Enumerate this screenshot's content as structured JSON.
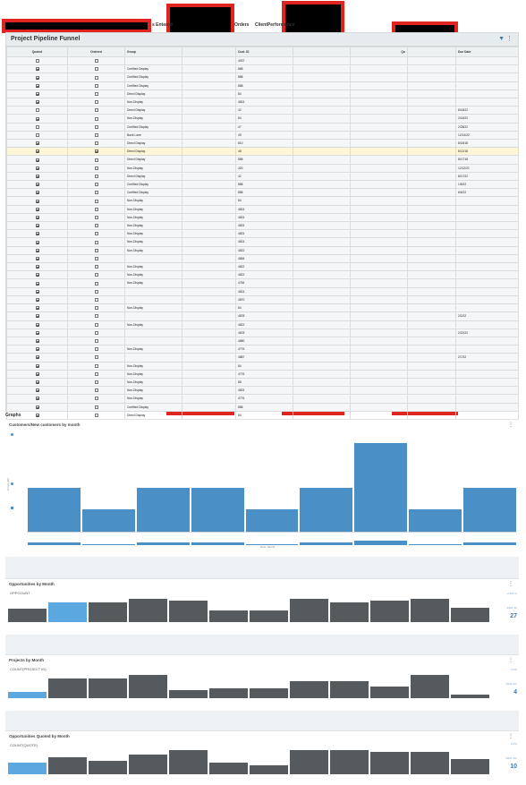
{
  "tabs": [
    "s Entered",
    "Orders",
    "ClientPerformance"
  ],
  "panel": {
    "title": "Project Pipeline Funnel",
    "filter_icon": "filter-icon",
    "menu_icon": "kebab-menu-icon",
    "columns": [
      "Quoted",
      "Ordered",
      "Group",
      "Cust. ID",
      "Qu",
      "Due Date"
    ]
  },
  "rows": [
    {
      "q": false,
      "o": false,
      "g": "",
      "id": "4937",
      "due": ""
    },
    {
      "q": true,
      "o": false,
      "g": "Certified Display",
      "id": "888",
      "due": ""
    },
    {
      "q": true,
      "o": false,
      "g": "Certified Display",
      "id": "888",
      "due": ""
    },
    {
      "q": true,
      "o": false,
      "g": "Certified Display",
      "id": "888",
      "due": ""
    },
    {
      "q": true,
      "o": false,
      "g": "Direct Display",
      "id": "84",
      "due": ""
    },
    {
      "q": true,
      "o": false,
      "g": "Non-Display",
      "id": "4824",
      "due": ""
    },
    {
      "q": false,
      "o": false,
      "g": "Direct Display",
      "id": "42",
      "due": "8/18/22"
    },
    {
      "q": true,
      "o": false,
      "g": "Non-Display",
      "id": "84",
      "due": "2/16/22"
    },
    {
      "q": false,
      "o": false,
      "g": "Certified Display",
      "id": "47",
      "due": "2/28/22"
    },
    {
      "q": false,
      "o": false,
      "g": "Bank Lane",
      "id": "49",
      "due": "12/14/22"
    },
    {
      "q": true,
      "o": false,
      "g": "Direct Display",
      "id": "810",
      "due": "8/18/18"
    },
    {
      "q": true,
      "o": true,
      "g": "Direct Display",
      "id": "48",
      "due": "8/12/18",
      "hl": true
    },
    {
      "q": true,
      "o": false,
      "g": "Direct Display",
      "id": "888",
      "due": "8/17/18"
    },
    {
      "q": true,
      "o": false,
      "g": "Non-Display",
      "id": "420",
      "due": "12/12/21"
    },
    {
      "q": true,
      "o": false,
      "g": "Direct Display",
      "id": "42",
      "due": "8/17/22"
    },
    {
      "q": true,
      "o": false,
      "g": "Certified Display",
      "id": "888",
      "due": "1/8/22"
    },
    {
      "q": true,
      "o": false,
      "g": "Certified Display",
      "id": "888",
      "due": "6/6/22"
    },
    {
      "q": true,
      "o": false,
      "g": "Non-Display",
      "id": "84",
      "due": ""
    },
    {
      "q": true,
      "o": false,
      "g": "Non-Display",
      "id": "4824",
      "due": ""
    },
    {
      "q": true,
      "o": false,
      "g": "Non-Display",
      "id": "4824",
      "due": ""
    },
    {
      "q": true,
      "o": false,
      "g": "Non-Display",
      "id": "4824",
      "due": ""
    },
    {
      "q": true,
      "o": false,
      "g": "Non-Display",
      "id": "4824",
      "due": ""
    },
    {
      "q": true,
      "o": false,
      "g": "Non-Display",
      "id": "4824",
      "due": ""
    },
    {
      "q": true,
      "o": false,
      "g": "Non-Display",
      "id": "4822",
      "due": ""
    },
    {
      "q": true,
      "o": false,
      "g": "",
      "id": "4884",
      "due": ""
    },
    {
      "q": true,
      "o": false,
      "g": "Non-Display",
      "id": "4822",
      "due": ""
    },
    {
      "q": true,
      "o": false,
      "g": "Non-Display",
      "id": "4822",
      "due": ""
    },
    {
      "q": true,
      "o": false,
      "g": "Non-Display",
      "id": "4784",
      "due": ""
    },
    {
      "q": true,
      "o": false,
      "g": "",
      "id": "4824",
      "due": ""
    },
    {
      "q": true,
      "o": false,
      "g": "",
      "id": "4870",
      "due": ""
    },
    {
      "q": true,
      "o": false,
      "g": "Non-Display",
      "id": "84",
      "due": ""
    },
    {
      "q": true,
      "o": false,
      "g": "",
      "id": "4878",
      "due": "2/2/22"
    },
    {
      "q": true,
      "o": false,
      "g": "Non-Display",
      "id": "4822",
      "due": ""
    },
    {
      "q": true,
      "o": false,
      "g": "",
      "id": "4878",
      "due": "2/22/22"
    },
    {
      "q": true,
      "o": false,
      "g": "",
      "id": "4880",
      "due": ""
    },
    {
      "q": true,
      "o": false,
      "g": "Non-Display",
      "id": "4776",
      "due": ""
    },
    {
      "q": true,
      "o": false,
      "g": "",
      "id": "4887",
      "due": "2/7/22"
    },
    {
      "q": true,
      "o": false,
      "g": "Non-Display",
      "id": "84",
      "due": ""
    },
    {
      "q": true,
      "o": false,
      "g": "Non-Display",
      "id": "4776",
      "due": ""
    },
    {
      "q": true,
      "o": false,
      "g": "Non-Display",
      "id": "88",
      "due": ""
    },
    {
      "q": true,
      "o": false,
      "g": "Non-Display",
      "id": "4824",
      "due": ""
    },
    {
      "q": true,
      "o": false,
      "g": "Non-Display",
      "id": "4776",
      "due": ""
    },
    {
      "q": true,
      "o": false,
      "g": "Certified Display",
      "id": "888",
      "due": ""
    },
    {
      "q": true,
      "o": false,
      "g": "Direct Display",
      "id": "84",
      "due": ""
    },
    {
      "q": true,
      "o": false,
      "g": "Direct Display",
      "id": "42",
      "due": ""
    },
    {
      "q": true,
      "o": false,
      "g": "",
      "id": "4888",
      "due": ""
    },
    {
      "q": true,
      "o": false,
      "g": "",
      "id": "4887",
      "due": ""
    },
    {
      "q": true,
      "o": false,
      "g": "",
      "id": "4887",
      "due": ""
    }
  ],
  "graphs_label": "Graphs",
  "chart_data": [
    {
      "type": "bar",
      "title": "Customers/New customers by month",
      "ylabel": "Count (ID)",
      "xlabel": "Date: Month",
      "ylim": [
        0,
        7
      ],
      "values": [
        3,
        1.5,
        3,
        3,
        1.5,
        3,
        6,
        1.5,
        3
      ],
      "colors": [
        "#4a90c6"
      ]
    },
    {
      "type": "bar",
      "title": "Opportunities by Month",
      "series_label": "OPPCOUNT",
      "values": [
        4,
        6,
        6,
        7,
        6.5,
        3.5,
        3.5,
        7,
        5.8,
        6.5,
        7,
        4.2
      ],
      "highlight_index": 1,
      "kpi_value": "27",
      "kpi_top": "+13% vs",
      "kpi_sub": "2024 Jul"
    },
    {
      "type": "bar",
      "title": "Projects by Month",
      "series_label": "COUNT(PROJECT ID)",
      "values": [
        2,
        6,
        6,
        7,
        2.5,
        3,
        3,
        5,
        5,
        3.5,
        7,
        1
      ],
      "highlight_index": 0,
      "kpi_value": "4",
      "kpi_top": "0.0%",
      "kpi_sub": "2024 Jun"
    },
    {
      "type": "bar",
      "title": "Opportunities Quoted by Month",
      "series_label": "COUNT(QUOTE)",
      "values": [
        4,
        5.5,
        4.5,
        6.5,
        8,
        4,
        3,
        8,
        8,
        7.5,
        7.5,
        5
      ],
      "highlight_index": 0,
      "kpi_value": "10",
      "kpi_top": "0.0%",
      "kpi_sub": "2024 Jun"
    }
  ]
}
